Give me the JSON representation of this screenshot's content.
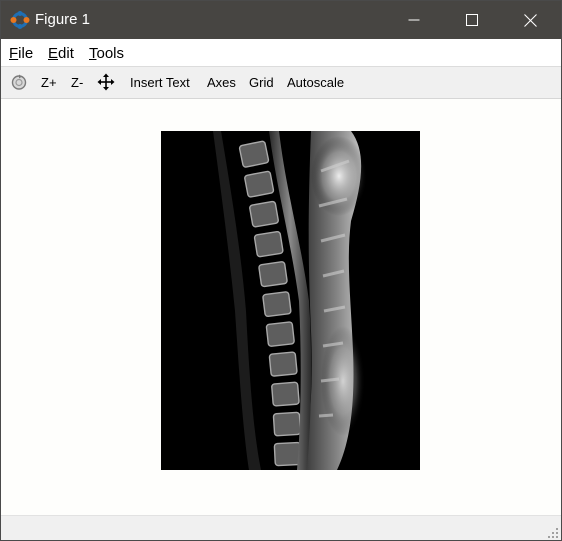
{
  "window": {
    "title": "Figure 1",
    "app_icon": "octave-icon",
    "controls": [
      "minimize-icon",
      "maximize-icon",
      "close-icon"
    ]
  },
  "menubar": {
    "items": [
      {
        "label": "File",
        "mnemonic": "F"
      },
      {
        "label": "Edit",
        "mnemonic": "E"
      },
      {
        "label": "Tools",
        "mnemonic": "T"
      }
    ]
  },
  "toolbar": {
    "rotate_icon": "rotate-icon",
    "zoom_in_label": "Z+",
    "zoom_out_label": "Z-",
    "pan_icon": "pan-icon",
    "insert_text_label": "Insert Text",
    "axes_label": "Axes",
    "grid_label": "Grid",
    "autoscale_label": "Autoscale"
  },
  "figure": {
    "image_subject": "sagittal spine MRI",
    "background_color": "#fefefc",
    "image_background": "#000000"
  },
  "statusbar": {
    "text": ""
  },
  "colors": {
    "titlebar": "#474542",
    "toolbar": "#f0f0f0",
    "menubar": "#ffffff",
    "icon_orange": "#e8761e",
    "icon_blue": "#1f6fb5"
  }
}
